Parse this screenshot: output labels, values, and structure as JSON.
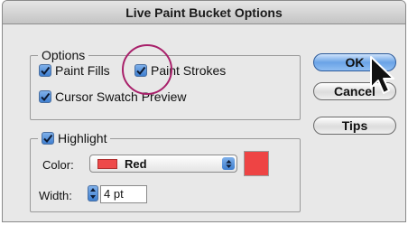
{
  "window": {
    "title": "Live Paint Bucket Options"
  },
  "options": {
    "legend": "Options",
    "paint_fills": {
      "label": "Paint Fills",
      "checked": true
    },
    "paint_strokes": {
      "label": "Paint Strokes",
      "checked": true
    },
    "cursor_swatch_preview": {
      "label": "Cursor Swatch Preview",
      "checked": true
    }
  },
  "highlight": {
    "legend": "Highlight",
    "checked": true,
    "color_label": "Color:",
    "color_value": "Red",
    "color_hex": "#ee4444",
    "width_label": "Width:",
    "width_value": "4 pt"
  },
  "buttons": {
    "ok": "OK",
    "cancel": "Cancel",
    "tips": "Tips"
  }
}
